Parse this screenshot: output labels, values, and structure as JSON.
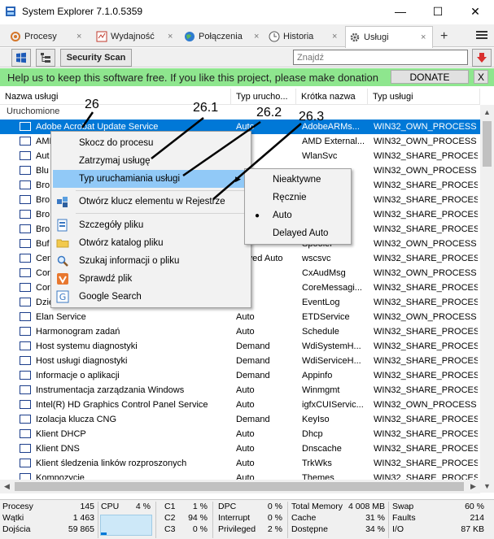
{
  "window": {
    "title": "System Explorer 7.1.0.5359",
    "minimize": "—",
    "maximize": "☐",
    "close": "✕"
  },
  "tabs": [
    {
      "label": "Procesy",
      "close": "×"
    },
    {
      "label": "Wydajność",
      "close": "×"
    },
    {
      "label": "Połączenia",
      "close": "×"
    },
    {
      "label": "Historia",
      "close": "×"
    },
    {
      "label": "Usługi",
      "close": "×"
    }
  ],
  "tab_add": "+",
  "toolbar": {
    "security_scan": "Security Scan",
    "search_placeholder": "Znajdź"
  },
  "banner": {
    "message": "Help us to keep this software free.  If you like this project, please make donation",
    "donate": "DONATE",
    "close": "X"
  },
  "columns": [
    "Nazwa usługi",
    "Typ urucho...",
    "Krótka nazwa",
    "Typ usługi"
  ],
  "group_label": "Uruchomione",
  "rows": [
    {
      "name": "Adobe Acrobat Update Service",
      "start": "Auto",
      "short": "AdobeARMs...",
      "type": "WIN32_OWN_PROCESS"
    },
    {
      "name": "AMD",
      "start": "",
      "short": "AMD External...",
      "type": "WIN32_OWN_PROCESS"
    },
    {
      "name": "Aut",
      "start": "",
      "short": "WlanSvc",
      "type": "WIN32_SHARE_PROCESS"
    },
    {
      "name": "Blu",
      "start": "",
      "short": "",
      "type": "WIN32_OWN_PROCESS"
    },
    {
      "name": "Bro",
      "start": "",
      "short": "vc",
      "type": "WIN32_SHARE_PROCESS"
    },
    {
      "name": "Bro",
      "start": "",
      "short": "",
      "type": "WIN32_SHARE_PROCESS"
    },
    {
      "name": "Bro",
      "start": "",
      "short": "",
      "type": "WIN32_SHARE_PROCESS"
    },
    {
      "name": "Bro",
      "start": "",
      "short": "",
      "type": "WIN32_SHARE_PROCESS"
    },
    {
      "name": "Buf",
      "start": "",
      "short": "Spooler",
      "type": "WIN32_OWN_PROCESS"
    },
    {
      "name": "Cen",
      "start": "elayed Auto",
      "short": "wscsvc",
      "type": "WIN32_SHARE_PROCESS"
    },
    {
      "name": "Cor",
      "start": "uto",
      "short": "CxAudMsg",
      "type": "WIN32_OWN_PROCESS"
    },
    {
      "name": "Cor",
      "start": "uto",
      "short": "CoreMessagi...",
      "type": "WIN32_SHARE_PROCESS"
    },
    {
      "name": "Dzie",
      "start": "uto",
      "short": "EventLog",
      "type": "WIN32_SHARE_PROCESS"
    },
    {
      "name": "Elan Service",
      "start": "Auto",
      "short": "ETDService",
      "type": "WIN32_OWN_PROCESS"
    },
    {
      "name": "Harmonogram zadań",
      "start": "Auto",
      "short": "Schedule",
      "type": "WIN32_SHARE_PROCESS"
    },
    {
      "name": "Host systemu diagnostyki",
      "start": "Demand",
      "short": "WdiSystemH...",
      "type": "WIN32_SHARE_PROCESS"
    },
    {
      "name": "Host usługi diagnostyki",
      "start": "Demand",
      "short": "WdiServiceH...",
      "type": "WIN32_SHARE_PROCESS"
    },
    {
      "name": "Informacje o aplikacji",
      "start": "Demand",
      "short": "Appinfo",
      "type": "WIN32_SHARE_PROCESS"
    },
    {
      "name": "Instrumentacja zarządzania Windows",
      "start": "Auto",
      "short": "Winmgmt",
      "type": "WIN32_SHARE_PROCESS"
    },
    {
      "name": "Intel(R) HD Graphics Control Panel Service",
      "start": "Auto",
      "short": "igfxCUIServic...",
      "type": "WIN32_OWN_PROCESS"
    },
    {
      "name": "Izolacja klucza CNG",
      "start": "Demand",
      "short": "KeyIso",
      "type": "WIN32_SHARE_PROCESS"
    },
    {
      "name": "Klient DHCP",
      "start": "Auto",
      "short": "Dhcp",
      "type": "WIN32_SHARE_PROCESS"
    },
    {
      "name": "Klient DNS",
      "start": "Auto",
      "short": "Dnscache",
      "type": "WIN32_SHARE_PROCESS"
    },
    {
      "name": "Klient śledzenia linków rozproszonych",
      "start": "Auto",
      "short": "TrkWks",
      "type": "WIN32_SHARE_PROCESS"
    },
    {
      "name": "Kompozycje",
      "start": "Auto",
      "short": "Themes",
      "type": "WIN32_SHARE_PROCESS"
    }
  ],
  "context_menu": {
    "items": [
      {
        "label": "Skocz do procesu",
        "icon": "jump-icon"
      },
      {
        "label": "Zatrzymaj usługę",
        "icon": "stop-icon"
      },
      {
        "label": "Typ uruchamiania usługi",
        "icon": "",
        "arrow": "▶"
      },
      {
        "label": "Otwórz klucz elementu w Rejestrze",
        "icon": "registry-icon"
      },
      {
        "label": "Szczegóły pliku",
        "icon": "file-details-icon"
      },
      {
        "label": "Otwórz katalog pliku",
        "icon": "folder-icon"
      },
      {
        "label": "Szukaj informacji o pliku",
        "icon": "search-icon"
      },
      {
        "label": "Sprawdź plik",
        "icon": "check-file-icon"
      },
      {
        "label": "Google Search",
        "icon": "google-icon"
      }
    ]
  },
  "submenu": {
    "items": [
      {
        "label": "Nieaktywne",
        "checked": false
      },
      {
        "label": "Ręcznie",
        "checked": false
      },
      {
        "label": "Auto",
        "checked": true
      },
      {
        "label": "Delayed Auto",
        "checked": false
      }
    ],
    "check_mark": "●"
  },
  "annotations": [
    "26",
    "26.1",
    "26.2",
    "26.3"
  ],
  "status": {
    "procesy_label": "Procesy",
    "procesy_value": "145",
    "watki_label": "Wątki",
    "watki_value": "1 463",
    "dojscia_label": "Dojścia",
    "dojscia_value": "59 865",
    "cpu_label": "CPU",
    "cpu_value": "4 %",
    "cpu_percent": 4,
    "c1_label": "C1",
    "c1_value": "1 %",
    "c2_label": "C2",
    "c2_value": "94 %",
    "c3_label": "C3",
    "c3_value": "0 %",
    "dpc_label": "DPC",
    "dpc_value": "0 %",
    "interrupt_label": "Interrupt",
    "interrupt_value": "0 %",
    "privileged_label": "Privileged",
    "privileged_value": "2 %",
    "totalmem_label": "Total Memory",
    "totalmem_value": "4 008 MB",
    "cache_label": "Cache",
    "cache_value": "31 %",
    "dostepne_label": "Dostępne",
    "dostepne_value": "34 %",
    "swap_label": "Swap",
    "swap_value": "60 %",
    "faults_label": "Faults",
    "faults_value": "214",
    "io_label": "I/O",
    "io_value": "87 KB"
  },
  "colors": {
    "selection": "#0078d7",
    "banner": "#8ee68e",
    "menu_highlight": "#91c9f7"
  }
}
